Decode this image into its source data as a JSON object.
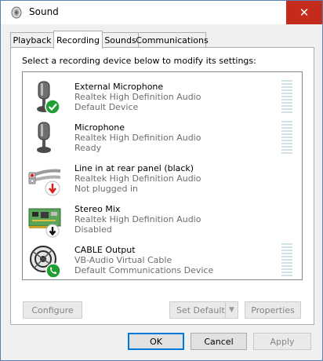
{
  "window": {
    "title": "Sound",
    "close_glyph": "✕"
  },
  "tabs": [
    {
      "label": "Playback",
      "active": false
    },
    {
      "label": "Recording",
      "active": true
    },
    {
      "label": "Sounds",
      "active": false
    },
    {
      "label": "Communications",
      "active": false
    }
  ],
  "instruction": "Select a recording device below to modify its settings:",
  "devices": [
    {
      "name": "External Microphone",
      "driver": "Realtek High Definition Audio",
      "status": "Default Device",
      "icon": "microphone-icon",
      "badge": "green-check-badge-icon"
    },
    {
      "name": "Microphone",
      "driver": "Realtek High Definition Audio",
      "status": "Ready",
      "icon": "microphone-icon",
      "badge": ""
    },
    {
      "name": "Line in at rear panel (black)",
      "driver": "Realtek High Definition Audio",
      "status": "Not plugged in",
      "icon": "rca-cable-icon",
      "badge": "red-down-arrow-badge-icon"
    },
    {
      "name": "Stereo Mix",
      "driver": "Realtek High Definition Audio",
      "status": "Disabled",
      "icon": "circuit-board-icon",
      "badge": "black-down-arrow-badge-icon"
    },
    {
      "name": "CABLE Output",
      "driver": "VB-Audio Virtual Cable",
      "status": "Default Communications Device",
      "icon": "cable-reel-icon",
      "badge": "green-phone-badge-icon"
    }
  ],
  "buttons": {
    "configure": "Configure",
    "set_default": "Set Default",
    "set_default_arrow": "▼",
    "properties": "Properties",
    "ok": "OK",
    "cancel": "Cancel",
    "apply": "Apply"
  },
  "colors": {
    "accent": "#0078d7",
    "close_button": "#c42b1c",
    "status_text": "#6d6d6d",
    "level_meter": "#cfe3e8",
    "check_green": "#1e9e33",
    "arrow_red": "#d42020"
  }
}
